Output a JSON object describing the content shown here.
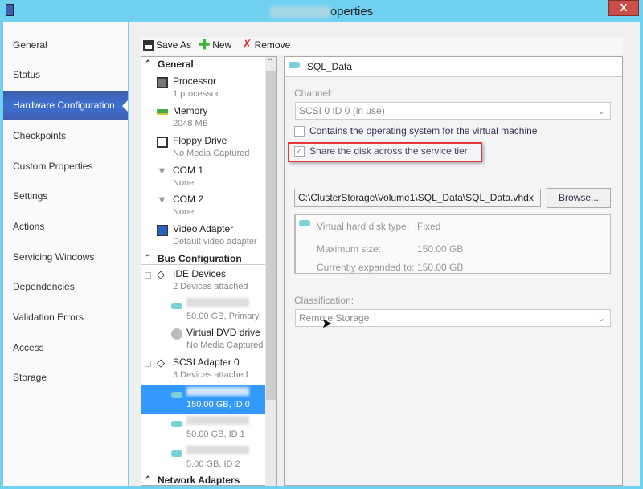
{
  "window": {
    "title_suffix": "operties",
    "close_label": "X"
  },
  "nav": {
    "items": [
      "General",
      "Status",
      "Hardware Configuration",
      "Checkpoints",
      "Custom Properties",
      "Settings",
      "Actions",
      "Servicing Windows",
      "Dependencies",
      "Validation Errors",
      "Access",
      "Storage"
    ],
    "selected": "Hardware Configuration"
  },
  "toolbar": {
    "save_as": "Save As",
    "new": "New",
    "remove": "Remove"
  },
  "tree": {
    "general": "General",
    "general_items": [
      {
        "name": "Processor",
        "detail": "1 processor",
        "icon": "processor-icon"
      },
      {
        "name": "Memory",
        "detail": "2048 MB",
        "icon": "memory-icon"
      },
      {
        "name": "Floppy Drive",
        "detail": "No Media Captured",
        "icon": "floppy-icon"
      },
      {
        "name": "COM 1",
        "detail": "None",
        "icon": "com-port-icon"
      },
      {
        "name": "COM 2",
        "detail": "None",
        "icon": "com-port-icon"
      },
      {
        "name": "Video Adapter",
        "detail": "Default video adapter",
        "icon": "monitor-icon"
      }
    ],
    "bus": "Bus Configuration",
    "ide": {
      "name": "IDE Devices",
      "detail": "2 Devices attached"
    },
    "ide_disk": {
      "detail": "50.00 GB, Primary"
    },
    "dvd": {
      "name": "Virtual DVD drive",
      "detail": "No Media Captured"
    },
    "scsi": {
      "name": "SCSI Adapter 0",
      "detail": "3 Devices attached"
    },
    "scsi_disks": [
      {
        "detail": "150.00 GB, ID 0"
      },
      {
        "detail": "50.00 GB, ID 1"
      },
      {
        "detail": "5.00 GB, ID 2"
      }
    ],
    "network": "Network Adapters"
  },
  "detail": {
    "title": "SQL_Data",
    "channel_label": "Channel:",
    "channel_value": "SCSI 0 ID 0 (in use)",
    "os_checkbox": "Contains the operating system for the virtual machine",
    "os_checked": false,
    "share_checkbox": "Share the disk across the service tier",
    "share_checked": true,
    "path": "C:\\ClusterStorage\\Volume1\\SQL_Data\\SQL_Data.vhdx",
    "browse": "Browse...",
    "vhd_type_label": "Virtual hard disk type:",
    "vhd_type": "Fixed",
    "max_size_label": "Maximum size:",
    "max_size": "150.00 GB",
    "expanded_label": "Currently expanded to:",
    "expanded": "150.00 GB",
    "classification_label": "Classification:",
    "classification_value": "Remote Storage",
    "highlight_color": "#e53935"
  }
}
